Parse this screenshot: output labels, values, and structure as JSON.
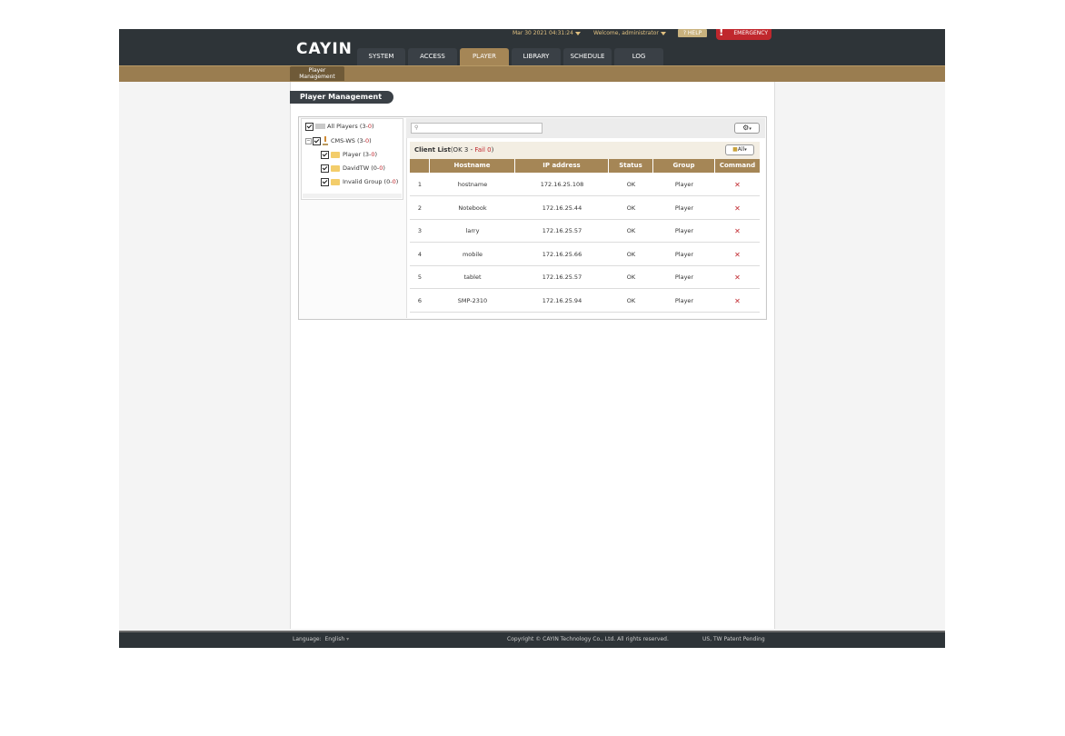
{
  "header": {
    "logo": "CAYIN",
    "datetime": "Mar 30 2021 04:31:24",
    "welcome": "Welcome, administrator",
    "help_label": "HELP",
    "emergency_label": "EMERGENCY"
  },
  "nav": {
    "tabs": [
      {
        "label": "SYSTEM"
      },
      {
        "label": "ACCESS"
      },
      {
        "label": "PLAYER"
      },
      {
        "label": "LIBRARY"
      },
      {
        "label": "SCHEDULE"
      },
      {
        "label": "LOG"
      }
    ],
    "active_tab": "PLAYER",
    "subtab_line1": "Player",
    "subtab_line2": "Management"
  },
  "page": {
    "title": "Player Management"
  },
  "tree": {
    "all_players": {
      "label": "All Players",
      "open": "(3-",
      "fail": "0",
      "close": ")"
    },
    "server": {
      "label": "CMS-WS",
      "open": "(3-",
      "fail": "0",
      "close": ")"
    },
    "groups": [
      {
        "label": "Player",
        "open": "(3-",
        "fail": "0",
        "close": ")"
      },
      {
        "label": "DavidTW",
        "open": "(0-",
        "fail": "0",
        "close": ")"
      },
      {
        "label": "Invalid Group",
        "open": "(0-",
        "fail": "0",
        "close": ")"
      }
    ]
  },
  "client_list": {
    "title": "Client List",
    "ok_text": "(OK 3 - ",
    "fail_text": "Fail 0",
    "close_paren": ")",
    "filter_label": "All",
    "columns": [
      "Hostname",
      "IP address",
      "Status",
      "Group",
      "Command"
    ],
    "rows": [
      {
        "num": "1",
        "hostname": "hostname",
        "ip": "172.16.25.108",
        "status": "OK",
        "group": "Player"
      },
      {
        "num": "2",
        "hostname": "Notebook",
        "ip": "172.16.25.44",
        "status": "OK",
        "group": "Player"
      },
      {
        "num": "3",
        "hostname": "larry",
        "ip": "172.16.25.57",
        "status": "OK",
        "group": "Player"
      },
      {
        "num": "4",
        "hostname": "mobile",
        "ip": "172.16.25.66",
        "status": "OK",
        "group": "Player"
      },
      {
        "num": "5",
        "hostname": "tablet",
        "ip": "172.16.25.57",
        "status": "OK",
        "group": "Player"
      },
      {
        "num": "6",
        "hostname": "SMP-2310",
        "ip": "172.16.25.94",
        "status": "OK",
        "group": "Player"
      }
    ]
  },
  "footer": {
    "language_label": "Language:",
    "language_value": "English",
    "copyright": "Copyright © CAYIN Technology Co., Ltd. All rights reserved.",
    "patent": "US, TW Patent Pending"
  },
  "colors": {
    "accent": "#a58656",
    "dark": "#2e3438",
    "danger": "#c0272d"
  }
}
